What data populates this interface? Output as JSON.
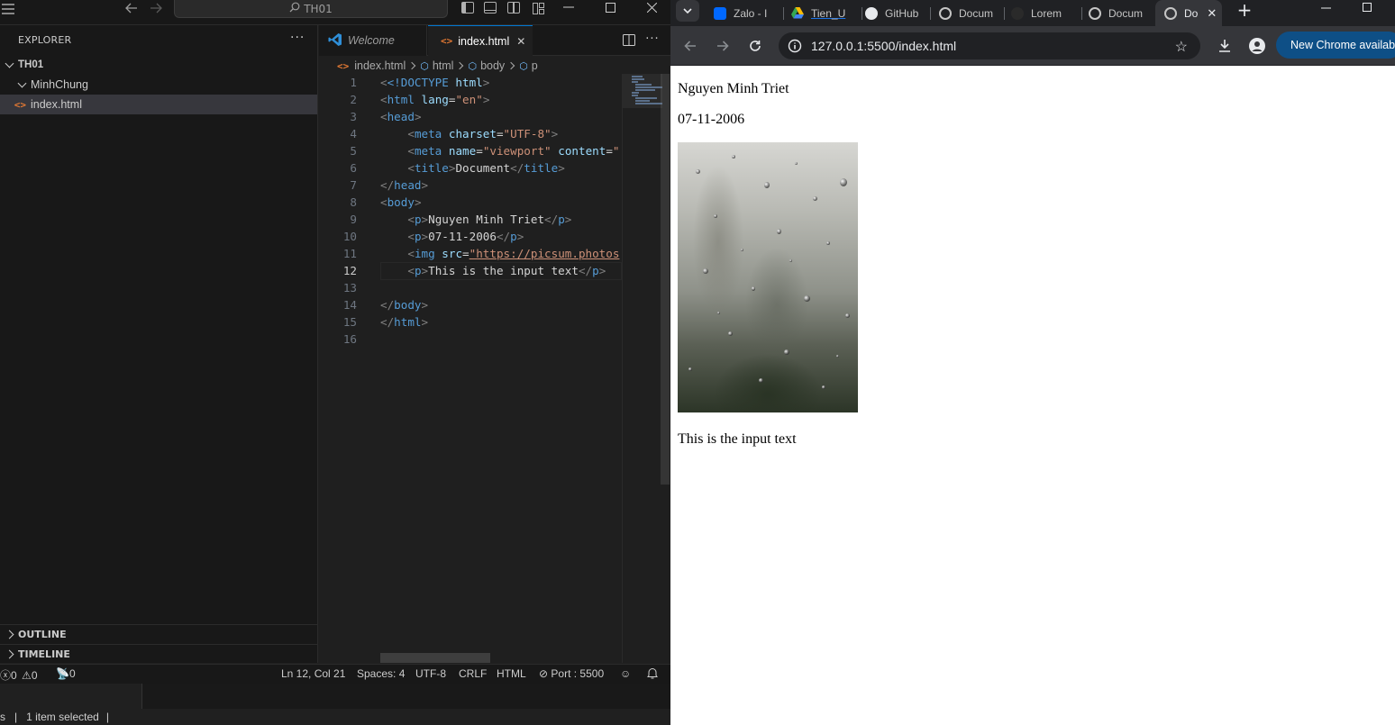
{
  "vscode": {
    "search_text": "TH01",
    "sidebar": {
      "title": "EXPLORER",
      "more": "···",
      "root": "TH01",
      "folder": "MinhChung",
      "file": "index.html",
      "outline": "OUTLINE",
      "timeline": "TIMELINE"
    },
    "tabs": [
      {
        "label": "Welcome"
      },
      {
        "label": "index.html",
        "close": "✕"
      }
    ],
    "breadcrumb": [
      "index.html",
      "html",
      "body",
      "p"
    ],
    "code_lines": [
      {
        "n": "1"
      },
      {
        "n": "2"
      },
      {
        "n": "3"
      },
      {
        "n": "4"
      },
      {
        "n": "5"
      },
      {
        "n": "6"
      },
      {
        "n": "7"
      },
      {
        "n": "8"
      },
      {
        "n": "9"
      },
      {
        "n": "10"
      },
      {
        "n": "11"
      },
      {
        "n": "12"
      },
      {
        "n": "13"
      },
      {
        "n": "14"
      },
      {
        "n": "15"
      },
      {
        "n": "16"
      }
    ],
    "code": {
      "l1_doctype": "<!DOCTYPE",
      "l1_html": " html",
      "l2_attr": "lang",
      "l2_val": "\"en\"",
      "l4_attr": "charset",
      "l4_val": "\"UTF-8\"",
      "l5_attr1": "name",
      "l5_val1": "\"viewport\"",
      "l5_attr2": "content",
      "l5_val2": "\"",
      "l6_text": "Document",
      "l9_text": "Nguyen Minh Triet",
      "l10_text": "07-11-2006",
      "l11_attr": "src",
      "l11_val": "\"https://picsum.photos",
      "l12_text": "This is the input text"
    },
    "status": {
      "errors": "0",
      "warnings": "0",
      "ports": "0",
      "position": "Ln 12, Col 21",
      "spaces": "Spaces: 4",
      "encoding": "UTF-8",
      "eol": "CRLF",
      "language": "HTML",
      "port": "Port : 5500"
    },
    "explorer_status": "1 item selected"
  },
  "chrome": {
    "tabs": [
      {
        "label": "Zalo - I"
      },
      {
        "label": "Tien_U"
      },
      {
        "label": "GitHub"
      },
      {
        "label": "Docum"
      },
      {
        "label": "Lorem"
      },
      {
        "label": "Docum"
      },
      {
        "label": "Do"
      }
    ],
    "url": "127.0.0.1:5500/index.html",
    "update_label": "New Chrome available",
    "page": {
      "line1": "Nguyen Minh Triet",
      "line2": "07-11-2006",
      "line3": "This is the input text"
    }
  },
  "colors": {
    "vscode_bg": "#1f1f1f",
    "tag": "#569cd6",
    "attr": "#9cdcfe",
    "string": "#ce9178",
    "accent": "#0078d4"
  }
}
